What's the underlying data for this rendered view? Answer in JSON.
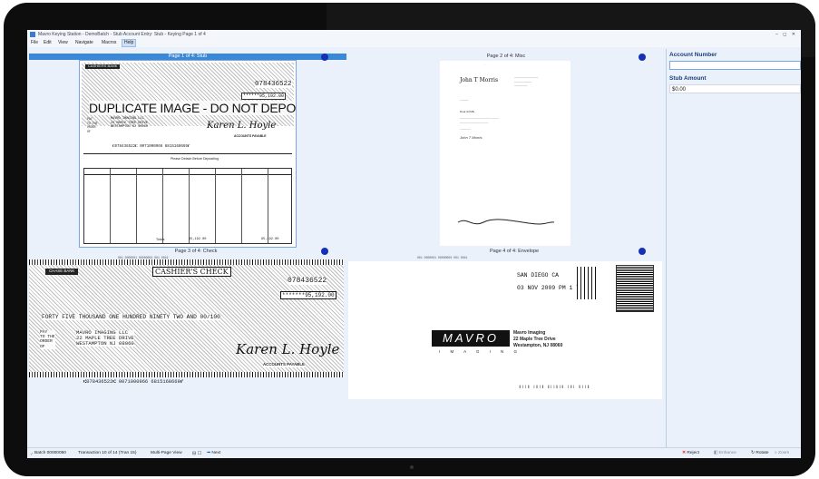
{
  "window": {
    "title": "Mavro Keying Station - DemoBatch - Stub Account Entry: Stub - Keying Page 1 of 4",
    "controls": "– ◻ ✕"
  },
  "menu": {
    "items": [
      "File",
      "Edit",
      "View",
      "Navigate",
      "Macros",
      "Help"
    ]
  },
  "pages": {
    "p1": {
      "caption": "Page 1 of 4: Stub"
    },
    "p2": {
      "caption": "Page 2 of 4: Misc"
    },
    "p3": {
      "caption": "Page 3 of 4: Check"
    },
    "p4": {
      "caption": "Page 4 of 4: Envelope"
    }
  },
  "stub": {
    "watermark": "DUPLICATE IMAGE - DO NOT DEPOSIT",
    "check_no": "078436522",
    "amount": "******95,192.00",
    "payee_lines": [
      "MAVRO IMAGING LLC",
      "22 MAPLE TREE DRIVE",
      "WESTAMPTON NJ 08060"
    ],
    "micr": "⑆078436522⑆ 0071000966 6815168669⑈",
    "detach": "Please Detach Before Depositing",
    "tab": "CASHIERS BANK",
    "totals_label": "Totals",
    "total1": "95,192.00",
    "total2": "95,192.00",
    "signer": "ACCOUNTS PAYABLE"
  },
  "letter": {
    "name": "John T Morris",
    "salutation": "Dear ACME,",
    "sign": "John T Morris"
  },
  "check": {
    "bank": "CHASE BANK",
    "type": "CASHIER'S CHECK",
    "number": "078436522",
    "amount": "*******95,192.00",
    "written": "FORTY FIVE THOUSAND ONE HUNDRED NINETY TWO AND 00/100",
    "pay_label": "PAY\nTO THE\nORDER\nOF",
    "payee_lines": [
      "MAVRO IMAGING LLC",
      "22 MAPLE TREE DRIVE",
      "WESTAMPTON NJ 08060"
    ],
    "signer": "ACCOUNTS PAYABLE",
    "micr": "⑆078436522⑆ 0071000966 6815168669⑈"
  },
  "envelope": {
    "postmark_city": "SAN DIEGO  CA",
    "postmark_date": "03 NOV 2009 PM 1 T",
    "logo": "MAVRO",
    "logo_sub": "I M A G I N G",
    "addr": [
      "Mavro Imaging",
      "22 Maple Tree Drive",
      "Westampton, NJ 08060"
    ],
    "barcode": "ǁǀǀǁ ǀǁǀǁ ǁǀǀǁǀǁ ǀǁǀ ǁǀǀǁ"
  },
  "fields": {
    "account_label": "Account Number",
    "account_value": "",
    "stub_amount_label": "Stub Amount",
    "stub_amount_value": "$0.00"
  },
  "status": {
    "batch": "Batch 00000050",
    "transaction": "Transaction 10 of 14 (Tran 15)",
    "view": "Multi-Page View",
    "next": "Next",
    "reject": "Reject",
    "enhance": "Enhance",
    "rotate": "Rotate",
    "zoom": "Zoom"
  },
  "colors": {
    "accent": "#3a89d8",
    "dot": "#1531b8",
    "label": "#1b3f7a",
    "reject": "#d22"
  }
}
